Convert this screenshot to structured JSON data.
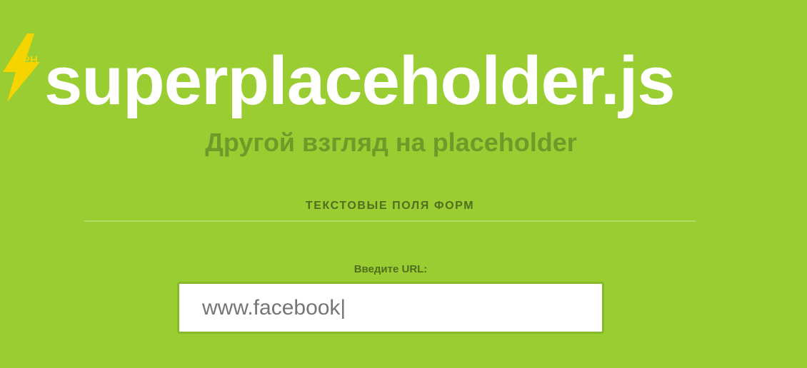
{
  "logo": {
    "badge_text": "PH",
    "icon": "lightning-bolt-icon",
    "color": "#f5d400"
  },
  "header": {
    "title": "superplaceholder.js",
    "subtitle": "Другой взгляд на placeholder"
  },
  "section": {
    "title": "ТЕКСТОВЫЕ ПОЛЯ ФОРМ"
  },
  "form": {
    "url_label": "Введите URL:",
    "url_placeholder": "www.facebook|"
  },
  "colors": {
    "background": "#9acd32",
    "title": "#ffffff",
    "subtitle": "#6e9a2a",
    "section_text": "#4f6f1f",
    "input_border": "#86b927"
  }
}
